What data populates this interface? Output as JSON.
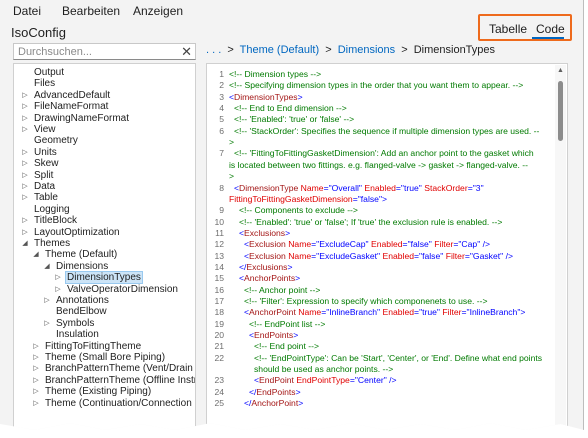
{
  "menu": {
    "items": [
      "Datei",
      "Bearbeiten",
      "Anzeigen"
    ]
  },
  "app": {
    "title": "IsoConfig"
  },
  "view_toggle": {
    "tabs": [
      "Tabelle",
      "Code"
    ],
    "active": "Code",
    "highlight_color": "#ee6a1c"
  },
  "search": {
    "placeholder": "Durchsuchen...",
    "value": "",
    "clear_icon": "close-icon"
  },
  "breadcrumb": {
    "prefix": ". . .",
    "items": [
      "Theme (Default)",
      "Dimensions",
      "DimensionTypes"
    ],
    "separator": ">"
  },
  "tree": {
    "items": [
      {
        "label": "Output",
        "level": 1,
        "expander": "none"
      },
      {
        "label": "Files",
        "level": 1,
        "expander": "none"
      },
      {
        "label": "AdvancedDefault",
        "level": 1,
        "expander": "collapsed"
      },
      {
        "label": "FileNameFormat",
        "level": 1,
        "expander": "collapsed"
      },
      {
        "label": "DrawingNameFormat",
        "level": 1,
        "expander": "collapsed"
      },
      {
        "label": "View",
        "level": 1,
        "expander": "collapsed"
      },
      {
        "label": "Geometry",
        "level": 1,
        "expander": "none"
      },
      {
        "label": "Units",
        "level": 1,
        "expander": "collapsed"
      },
      {
        "label": "Skew",
        "level": 1,
        "expander": "collapsed"
      },
      {
        "label": "Split",
        "level": 1,
        "expander": "collapsed"
      },
      {
        "label": "Data",
        "level": 1,
        "expander": "collapsed"
      },
      {
        "label": "Table",
        "level": 1,
        "expander": "collapsed"
      },
      {
        "label": "Logging",
        "level": 1,
        "expander": "none"
      },
      {
        "label": "TitleBlock",
        "level": 1,
        "expander": "collapsed"
      },
      {
        "label": "LayoutOptimization",
        "level": 1,
        "expander": "collapsed"
      },
      {
        "label": "Themes",
        "level": 1,
        "expander": "expanded"
      },
      {
        "label": "Theme (Default)",
        "level": 2,
        "expander": "expanded"
      },
      {
        "label": "Dimensions",
        "level": 3,
        "expander": "expanded"
      },
      {
        "label": "DimensionTypes",
        "level": 4,
        "expander": "collapsed",
        "selected": true
      },
      {
        "label": "ValveOperatorDimension",
        "level": 4,
        "expander": "collapsed"
      },
      {
        "label": "Annotations",
        "level": 3,
        "expander": "collapsed"
      },
      {
        "label": "BendElbow",
        "level": 3,
        "expander": "none"
      },
      {
        "label": "Symbols",
        "level": 3,
        "expander": "collapsed"
      },
      {
        "label": "Insulation",
        "level": 3,
        "expander": "none"
      },
      {
        "label": "FittingToFittingTheme",
        "level": 2,
        "expander": "collapsed"
      },
      {
        "label": "Theme (Small Bore Piping)",
        "level": 2,
        "expander": "collapsed"
      },
      {
        "label": "BranchPatternTheme (Vent/Drain Pipi",
        "level": 2,
        "expander": "collapsed"
      },
      {
        "label": "BranchPatternTheme (Offline Instrume",
        "level": 2,
        "expander": "collapsed"
      },
      {
        "label": "Theme (Existing Piping)",
        "level": 2,
        "expander": "collapsed"
      },
      {
        "label": "Theme (Continuation/Connection Pipi",
        "level": 2,
        "expander": "collapsed"
      }
    ]
  },
  "editor": {
    "lines": [
      {
        "n": "1",
        "indent": 0,
        "parts": [
          {
            "t": "c-comment",
            "s": "<!-- Dimension types -->"
          }
        ]
      },
      {
        "n": "2",
        "indent": 0,
        "parts": [
          {
            "t": "c-comment",
            "s": "<!-- Specifying dimension types in the order that you want them to appear. -->"
          }
        ]
      },
      {
        "n": "3",
        "indent": 0,
        "parts": [
          {
            "t": "c-punct",
            "s": "<"
          },
          {
            "t": "c-tag",
            "s": "DimensionTypes"
          },
          {
            "t": "c-punct",
            "s": ">"
          }
        ]
      },
      {
        "n": "4",
        "indent": 1,
        "parts": [
          {
            "t": "c-comment",
            "s": "<!-- End to End dimension -->"
          }
        ]
      },
      {
        "n": "5",
        "indent": 1,
        "parts": [
          {
            "t": "c-comment",
            "s": "<!-- 'Enabled': 'true' or 'false' -->"
          }
        ]
      },
      {
        "n": "6",
        "indent": 1,
        "parts": [
          {
            "t": "c-comment",
            "s": "<!-- 'StackOrder': Specifies the sequence if multiple dimension types are used. --"
          }
        ]
      },
      {
        "n": "",
        "indent": 0,
        "parts": [
          {
            "t": "c-comment",
            "s": ">"
          }
        ]
      },
      {
        "n": "7",
        "indent": 1,
        "parts": [
          {
            "t": "c-comment",
            "s": "<!-- 'FittingToFittingGasketDimension': Add an anchor point to the gasket which"
          }
        ]
      },
      {
        "n": "",
        "indent": 0,
        "parts": [
          {
            "t": "c-comment",
            "s": "is located between two fittings. e.g. flanged-valve -> gasket -> flanged-valve. --"
          }
        ]
      },
      {
        "n": "",
        "indent": 0,
        "parts": [
          {
            "t": "c-comment",
            "s": ">"
          }
        ]
      },
      {
        "n": "8",
        "indent": 1,
        "parts": [
          {
            "t": "c-punct",
            "s": "<"
          },
          {
            "t": "c-tag",
            "s": "DimensionType "
          },
          {
            "t": "c-attr",
            "s": "Name"
          },
          {
            "t": "c-punct",
            "s": "="
          },
          {
            "t": "c-val",
            "s": "\"Overall\" "
          },
          {
            "t": "c-attr",
            "s": "Enabled"
          },
          {
            "t": "c-punct",
            "s": "="
          },
          {
            "t": "c-val",
            "s": "\"true\" "
          },
          {
            "t": "c-attr",
            "s": "StackOrder"
          },
          {
            "t": "c-punct",
            "s": "="
          },
          {
            "t": "c-val",
            "s": "\"3\""
          }
        ]
      },
      {
        "n": "",
        "indent": 0,
        "parts": [
          {
            "t": "c-attr",
            "s": "FittingToFittingGasketDimension"
          },
          {
            "t": "c-punct",
            "s": "="
          },
          {
            "t": "c-val",
            "s": "\"false\""
          },
          {
            "t": "c-punct",
            "s": ">"
          }
        ]
      },
      {
        "n": "9",
        "indent": 2,
        "parts": [
          {
            "t": "c-comment",
            "s": "<!-- Components to exclude -->"
          }
        ]
      },
      {
        "n": "10",
        "indent": 2,
        "parts": [
          {
            "t": "c-comment",
            "s": "<!-- 'Enabled': 'true' or 'false'; If 'true' the exclusion rule is enabled. -->"
          }
        ]
      },
      {
        "n": "11",
        "indent": 2,
        "parts": [
          {
            "t": "c-punct",
            "s": "<"
          },
          {
            "t": "c-tag",
            "s": "Exclusions"
          },
          {
            "t": "c-punct",
            "s": ">"
          }
        ]
      },
      {
        "n": "12",
        "indent": 3,
        "parts": [
          {
            "t": "c-punct",
            "s": "<"
          },
          {
            "t": "c-tag",
            "s": "Exclusion "
          },
          {
            "t": "c-attr",
            "s": "Name"
          },
          {
            "t": "c-punct",
            "s": "="
          },
          {
            "t": "c-val",
            "s": "\"ExcludeCap\" "
          },
          {
            "t": "c-attr",
            "s": "Enabled"
          },
          {
            "t": "c-punct",
            "s": "="
          },
          {
            "t": "c-val",
            "s": "\"false\" "
          },
          {
            "t": "c-attr",
            "s": "Filter"
          },
          {
            "t": "c-punct",
            "s": "="
          },
          {
            "t": "c-val",
            "s": "\"Cap\" "
          },
          {
            "t": "c-punct",
            "s": "/>"
          }
        ]
      },
      {
        "n": "13",
        "indent": 3,
        "parts": [
          {
            "t": "c-punct",
            "s": "<"
          },
          {
            "t": "c-tag",
            "s": "Exclusion "
          },
          {
            "t": "c-attr",
            "s": "Name"
          },
          {
            "t": "c-punct",
            "s": "="
          },
          {
            "t": "c-val",
            "s": "\"ExcludeGasket\" "
          },
          {
            "t": "c-attr",
            "s": "Enabled"
          },
          {
            "t": "c-punct",
            "s": "="
          },
          {
            "t": "c-val",
            "s": "\"false\" "
          },
          {
            "t": "c-attr",
            "s": "Filter"
          },
          {
            "t": "c-punct",
            "s": "="
          },
          {
            "t": "c-val",
            "s": "\"Gasket\" "
          },
          {
            "t": "c-punct",
            "s": "/>"
          }
        ]
      },
      {
        "n": "14",
        "indent": 2,
        "parts": [
          {
            "t": "c-punct",
            "s": "</"
          },
          {
            "t": "c-tag",
            "s": "Exclusions"
          },
          {
            "t": "c-punct",
            "s": ">"
          }
        ]
      },
      {
        "n": "15",
        "indent": 2,
        "parts": [
          {
            "t": "c-punct",
            "s": "<"
          },
          {
            "t": "c-tag",
            "s": "AnchorPoints"
          },
          {
            "t": "c-punct",
            "s": ">"
          }
        ]
      },
      {
        "n": "16",
        "indent": 3,
        "parts": [
          {
            "t": "c-comment",
            "s": "<!-- Anchor point -->"
          }
        ]
      },
      {
        "n": "17",
        "indent": 3,
        "parts": [
          {
            "t": "c-comment",
            "s": "<!-- 'Filter': Expression to specify which componenets to use. -->"
          }
        ]
      },
      {
        "n": "18",
        "indent": 3,
        "parts": [
          {
            "t": "c-punct",
            "s": "<"
          },
          {
            "t": "c-tag",
            "s": "AnchorPoint "
          },
          {
            "t": "c-attr",
            "s": "Name"
          },
          {
            "t": "c-punct",
            "s": "="
          },
          {
            "t": "c-val",
            "s": "\"InlineBranch\" "
          },
          {
            "t": "c-attr",
            "s": "Enabled"
          },
          {
            "t": "c-punct",
            "s": "="
          },
          {
            "t": "c-val",
            "s": "\"true\" "
          },
          {
            "t": "c-attr",
            "s": "Filter"
          },
          {
            "t": "c-punct",
            "s": "="
          },
          {
            "t": "c-val",
            "s": "\"InlineBranch\""
          },
          {
            "t": "c-punct",
            "s": ">"
          }
        ]
      },
      {
        "n": "19",
        "indent": 4,
        "parts": [
          {
            "t": "c-comment",
            "s": "<!-- EndPoint list -->"
          }
        ]
      },
      {
        "n": "20",
        "indent": 4,
        "parts": [
          {
            "t": "c-punct",
            "s": "<"
          },
          {
            "t": "c-tag",
            "s": "EndPoints"
          },
          {
            "t": "c-punct",
            "s": ">"
          }
        ]
      },
      {
        "n": "21",
        "indent": 5,
        "parts": [
          {
            "t": "c-comment",
            "s": "<!-- End point -->"
          }
        ]
      },
      {
        "n": "22",
        "indent": 5,
        "parts": [
          {
            "t": "c-comment",
            "s": "<!-- 'EndPointType': Can be 'Start', 'Center', or 'End'. Define what end points"
          }
        ]
      },
      {
        "n": "",
        "indent": 5,
        "parts": [
          {
            "t": "c-comment",
            "s": "should be used as anchor points. -->"
          }
        ]
      },
      {
        "n": "23",
        "indent": 5,
        "parts": [
          {
            "t": "c-punct",
            "s": "<"
          },
          {
            "t": "c-tag",
            "s": "EndPoint "
          },
          {
            "t": "c-attr",
            "s": "EndPointType"
          },
          {
            "t": "c-punct",
            "s": "="
          },
          {
            "t": "c-val",
            "s": "\"Center\" "
          },
          {
            "t": "c-punct",
            "s": "/>"
          }
        ]
      },
      {
        "n": "24",
        "indent": 4,
        "parts": [
          {
            "t": "c-punct",
            "s": "</"
          },
          {
            "t": "c-tag",
            "s": "EndPoints"
          },
          {
            "t": "c-punct",
            "s": ">"
          }
        ]
      },
      {
        "n": "25",
        "indent": 3,
        "parts": [
          {
            "t": "c-punct",
            "s": "</"
          },
          {
            "t": "c-tag",
            "s": "AnchorPoint"
          },
          {
            "t": "c-punct",
            "s": ">"
          }
        ]
      }
    ]
  }
}
